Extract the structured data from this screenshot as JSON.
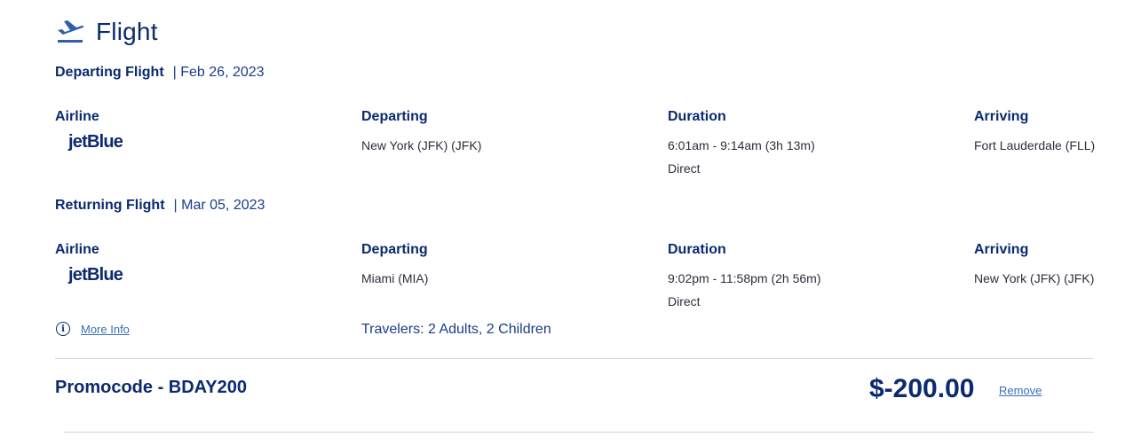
{
  "section": {
    "title": "Flight",
    "icon": "airplane-departure-icon"
  },
  "departing": {
    "label": "Departing Flight",
    "date": "| Feb 26, 2023",
    "headers": {
      "airline": "Airline",
      "departing": "Departing",
      "duration": "Duration",
      "arriving": "Arriving"
    },
    "airline": "jetBlue",
    "from": "New York (JFK) (JFK)",
    "time": "6:01am - 9:14am (3h 13m)",
    "stops": "Direct",
    "to": "Fort Lauderdale (FLL)"
  },
  "returning": {
    "label": "Returning Flight",
    "date": "| Mar 05, 2023",
    "headers": {
      "airline": "Airline",
      "departing": "Departing",
      "duration": "Duration",
      "arriving": "Arriving"
    },
    "airline": "jetBlue",
    "from": "Miami (MIA)",
    "time": "9:02pm - 11:58pm (2h 56m)",
    "stops": "Direct",
    "to": "New York (JFK) (JFK)"
  },
  "more_info": {
    "label": "More Info",
    "icon": "info-icon"
  },
  "travelers": "Travelers: 2 Adults, 2 Children",
  "promo": {
    "label": "Promocode - BDAY200",
    "amount": "$-200.00",
    "remove_label": "Remove"
  },
  "colors": {
    "brand": "#0b2a6f",
    "link": "#3b6fb6",
    "divider": "#d6d6d6"
  }
}
